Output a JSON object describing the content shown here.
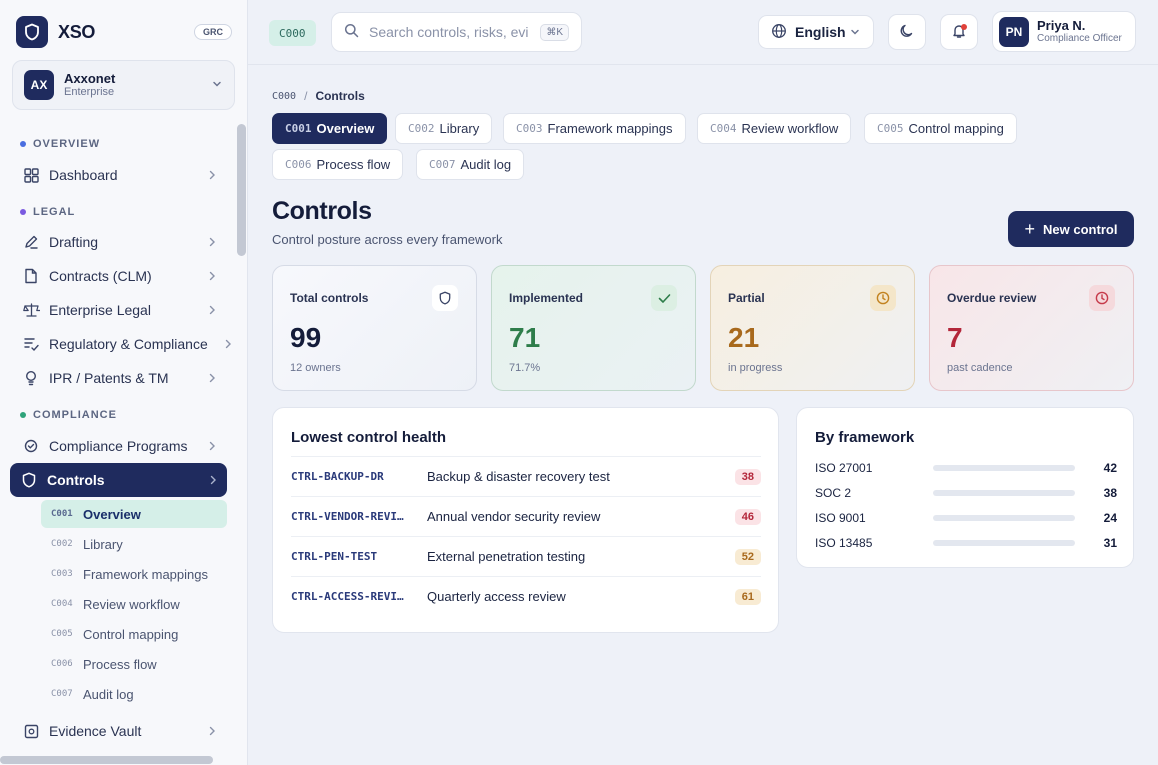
{
  "brand": {
    "name": "XSO",
    "badge": "GRC"
  },
  "org": {
    "initials": "AX",
    "name": "Axxonet",
    "plan": "Enterprise"
  },
  "sidebar": {
    "sections": [
      {
        "label": "OVERVIEW",
        "color": "#4a6ee0"
      },
      {
        "label": "LEGAL",
        "color": "#7a5ae0"
      },
      {
        "label": "COMPLIANCE",
        "color": "#2fa37a"
      }
    ],
    "items": [
      {
        "label": "Dashboard",
        "icon": "grid-icon"
      },
      {
        "label": "Drafting",
        "icon": "pen-icon"
      },
      {
        "label": "Contracts (CLM)",
        "icon": "file-icon"
      },
      {
        "label": "Enterprise Legal",
        "icon": "scale-icon"
      },
      {
        "label": "Regulatory & Compliance",
        "icon": "list-check-icon"
      },
      {
        "label": "IPR / Patents & TM",
        "icon": "bulb-icon"
      },
      {
        "label": "Compliance Programs",
        "icon": "badge-icon"
      },
      {
        "label": "Controls",
        "icon": "shield-icon"
      },
      {
        "label": "Evidence Vault",
        "icon": "vault-icon"
      }
    ],
    "subitems": [
      {
        "code": "C001",
        "label": "Overview"
      },
      {
        "code": "C002",
        "label": "Library"
      },
      {
        "code": "C003",
        "label": "Framework mappings"
      },
      {
        "code": "C004",
        "label": "Review workflow"
      },
      {
        "code": "C005",
        "label": "Control mapping"
      },
      {
        "code": "C006",
        "label": "Process flow"
      },
      {
        "code": "C007",
        "label": "Audit log"
      }
    ]
  },
  "topbar": {
    "code": "C000",
    "search_placeholder": "Search controls, risks, evi",
    "shortcut": "⌘K",
    "language": "English",
    "user": {
      "initials": "PN",
      "name": "Priya N.",
      "role": "Compliance Officer"
    }
  },
  "breadcrumb": {
    "code": "C000",
    "separator": "/",
    "current": "Controls"
  },
  "tabs": [
    {
      "code": "C001",
      "label": "Overview"
    },
    {
      "code": "C002",
      "label": "Library"
    },
    {
      "code": "C003",
      "label": "Framework mappings"
    },
    {
      "code": "C004",
      "label": "Review workflow"
    },
    {
      "code": "C005",
      "label": "Control mapping"
    },
    {
      "code": "C006",
      "label": "Process flow"
    },
    {
      "code": "C007",
      "label": "Audit log"
    }
  ],
  "page": {
    "title": "Controls",
    "subtitle": "Control posture across every framework",
    "new_button": "New control"
  },
  "stats": [
    {
      "label": "Total controls",
      "value": "99",
      "sub": "12 owners",
      "icon": "shield-icon"
    },
    {
      "label": "Implemented",
      "value": "71",
      "sub": "71.7%",
      "icon": "check-icon"
    },
    {
      "label": "Partial",
      "value": "21",
      "sub": "in progress",
      "icon": "clock-icon"
    },
    {
      "label": "Overdue review",
      "value": "7",
      "sub": "past cadence",
      "icon": "clock-icon"
    }
  ],
  "lowest_health": {
    "title": "Lowest control health",
    "rows": [
      {
        "id": "CTRL-BACKUP-DR",
        "name": "Backup & disaster recovery test",
        "score": "38"
      },
      {
        "id": "CTRL-VENDOR-REVI…",
        "name": "Annual vendor security review",
        "score": "46"
      },
      {
        "id": "CTRL-PEN-TEST",
        "name": "External penetration testing",
        "score": "52"
      },
      {
        "id": "CTRL-ACCESS-REVI…",
        "name": "Quarterly access review",
        "score": "61"
      }
    ]
  },
  "by_framework": {
    "title": "By framework",
    "rows": [
      {
        "name": "ISO 27001",
        "value": "42"
      },
      {
        "name": "SOC 2",
        "value": "38"
      },
      {
        "name": "ISO 9001",
        "value": "24"
      },
      {
        "name": "ISO 13485",
        "value": "31"
      }
    ]
  },
  "colors": {
    "navy": "#1f2b5e",
    "mint": "#d5efe8",
    "implemented": "#2e7d4a",
    "partial": "#a8691c",
    "overdue": "#b3263a"
  }
}
